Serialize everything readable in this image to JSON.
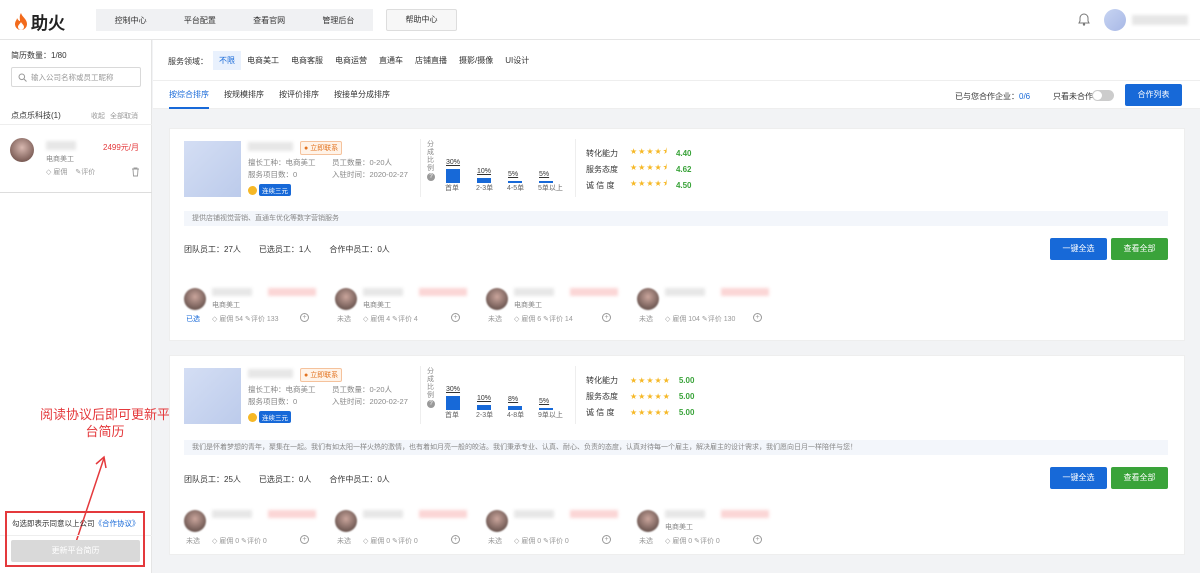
{
  "app": {
    "logo_text": "助火"
  },
  "nav": {
    "items": [
      "控制中心",
      "平台配置",
      "查看官网",
      "管理后台"
    ],
    "help": "帮助中心"
  },
  "sidebar": {
    "count_text": "简历数量：1/80",
    "search_placeholder": "输入公司名称或员工昵称",
    "company": "点点乐科技(1)",
    "collapse": "收起",
    "cancel_all": "全部取消",
    "card": {
      "price": "2499元/月",
      "role": "电商美工",
      "hire": "雇佣",
      "review": "评价"
    },
    "annotation": "阅读协议后即可更新平台简历",
    "agreement_text": "勾选即表示同意以上公司",
    "agreement_link": "《合作协议》",
    "update_button": "更新平台简历"
  },
  "filter": {
    "label": "服务领域：",
    "items": [
      "不限",
      "电商美工",
      "电商客服",
      "电商运营",
      "直通车",
      "店铺直播",
      "摄影/摄像",
      "UI设计"
    ],
    "active": 0
  },
  "sort": {
    "tabs": [
      "按综合排序",
      "按规模排序",
      "按评价排序",
      "按接单分成排序"
    ],
    "active": 0,
    "coop_label": "已与您合作企业：",
    "coop_value": "0/6",
    "only_uncoop": "只看未合作",
    "coop_list_button": "合作列表"
  },
  "cards": [
    {
      "contact": "立即联系",
      "tag": "连续三元",
      "info_left": [
        "擅长工种：电商美工",
        "服务项目数：0"
      ],
      "info_right": [
        "员工数量：0-20人",
        "入驻时间：2020-02-27"
      ],
      "dist_label": "分成比例",
      "dist": {
        "categories": [
          "首单",
          "2-3单",
          "4-5单",
          "5单以上"
        ],
        "values": [
          30,
          10,
          5,
          5
        ]
      },
      "ratings": [
        {
          "label": "转化能力",
          "stars": 4.5,
          "value": "4.40"
        },
        {
          "label": "服务态度",
          "stars": 4.5,
          "value": "4.62"
        },
        {
          "label": "诚 信 度",
          "stars": 4.5,
          "value": "4.50"
        }
      ],
      "desc": "提供店铺视觉营销、直通车优化等数字营销服务",
      "stats": [
        "团队员工：27人",
        "已选员工：1人",
        "合作中员工：0人"
      ],
      "btn_select_all": "一键全选",
      "btn_view_all": "查看全部",
      "members": [
        {
          "role": "电商美工",
          "status": "已选",
          "hire": "雇佣 54",
          "review": "评价 133",
          "selected": true
        },
        {
          "role": "电商美工",
          "status": "未选",
          "hire": "雇佣 4",
          "review": "评价 4",
          "selected": false
        },
        {
          "role": "电商美工",
          "status": "未选",
          "hire": "雇佣 6",
          "review": "评价 14",
          "selected": false
        },
        {
          "role": "",
          "status": "未选",
          "hire": "雇佣 104",
          "review": "评价 130",
          "selected": false
        }
      ]
    },
    {
      "contact": "立即联系",
      "tag": "连续三元",
      "info_left": [
        "擅长工种：电商美工",
        "服务项目数：0"
      ],
      "info_right": [
        "员工数量：0-20人",
        "入驻时间：2020-02-27"
      ],
      "dist_label": "分成比例",
      "dist": {
        "categories": [
          "首单",
          "2-3单",
          "4-8单",
          "9单以上"
        ],
        "values": [
          30,
          10,
          8,
          5
        ]
      },
      "ratings": [
        {
          "label": "转化能力",
          "stars": 5,
          "value": "5.00"
        },
        {
          "label": "服务态度",
          "stars": 5,
          "value": "5.00"
        },
        {
          "label": "诚 信 度",
          "stars": 5,
          "value": "5.00"
        }
      ],
      "desc": "我们是怀着梦想的青年，聚集在一起。我们有如太阳一样火热的激情，也有着如月亮一般的皎洁。我们秉承专业、认真、耐心、负责的态度，认真对待每一个雇主，解决雇主的设计需求，我们愿向日月一样陪伴与您！",
      "stats": [
        "团队员工：25人",
        "已选员工：0人",
        "合作中员工：0人"
      ],
      "btn_select_all": "一键全选",
      "btn_view_all": "查看全部",
      "members": [
        {
          "role": "",
          "status": "未选",
          "hire": "雇佣 0",
          "review": "评价 0",
          "selected": false
        },
        {
          "role": "",
          "status": "未选",
          "hire": "雇佣 0",
          "review": "评价 0",
          "selected": false
        },
        {
          "role": "",
          "status": "未选",
          "hire": "雇佣 0",
          "review": "评价 0",
          "selected": false
        },
        {
          "role": "电商美工",
          "status": "未选",
          "hire": "雇佣 0",
          "review": "评价 0",
          "selected": false
        }
      ]
    }
  ]
}
